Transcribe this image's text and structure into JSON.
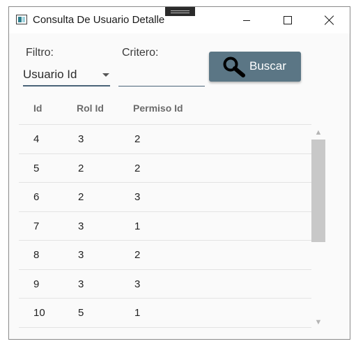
{
  "window": {
    "title": "Consulta De Usuario Detalle",
    "minimize_symbol": "—",
    "maximize_symbol": "☐",
    "close_symbol": "✕"
  },
  "filter": {
    "filtro_label": "Filtro:",
    "filtro_value": "Usuario Id",
    "criterio_label": "Critero:",
    "criterio_value": "",
    "search_button_label": "Buscar",
    "search_icon": "magnifier-icon"
  },
  "table": {
    "columns": [
      "Id",
      "Rol Id",
      "Permiso Id"
    ],
    "rows": [
      [
        "4",
        "3",
        "2"
      ],
      [
        "5",
        "2",
        "2"
      ],
      [
        "6",
        "2",
        "3"
      ],
      [
        "7",
        "3",
        "1"
      ],
      [
        "8",
        "3",
        "2"
      ],
      [
        "9",
        "3",
        "3"
      ],
      [
        "10",
        "5",
        "1"
      ]
    ]
  },
  "colors": {
    "accent": "#5b7685",
    "underline": "#4a6478"
  }
}
